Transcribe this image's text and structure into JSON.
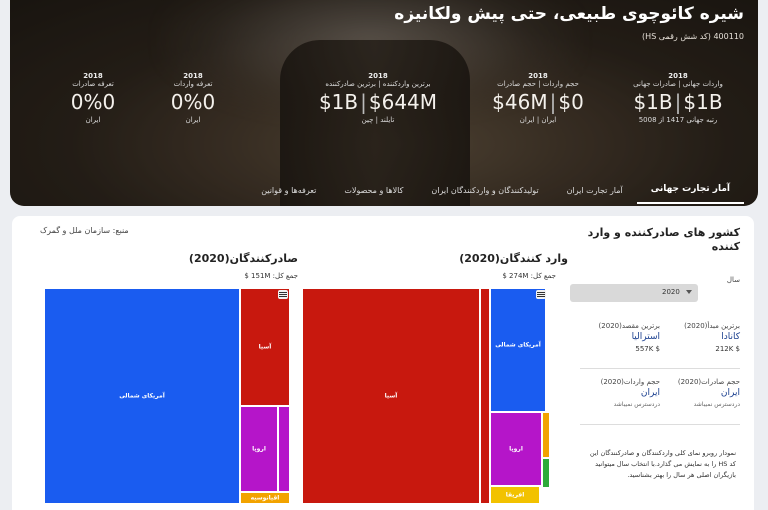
{
  "hero": {
    "title": "شیره کائوچوی طبیعی، حتی پیش ولکانیزه",
    "code": "400110 (کد شش رقمی HS)",
    "stats": [
      {
        "year": "2018",
        "label": "واردات جهانی | صادرات جهانی",
        "value_a": "$1B",
        "value_b": "$1B",
        "sub": "رتبه جهانی 1417 از 5008"
      },
      {
        "year": "2018",
        "label": "حجم واردات | حجم صادرات",
        "value_a": "$46M",
        "value_b": "$0",
        "sub": "ایران | ایران"
      },
      {
        "year": "2018",
        "label": "برترین واردکننده | برترین صادرکننده",
        "value_a": "$644M",
        "value_b": "$1B",
        "sub": "تایلند | چین"
      },
      {
        "year": "2018",
        "label": "تعرفه واردات",
        "value_a": "0%0",
        "value_b": "",
        "sub": "ایران"
      },
      {
        "year": "2018",
        "label": "تعرفه صادرات",
        "value_a": "0%0",
        "value_b": "",
        "sub": "ایران"
      }
    ],
    "tabs": [
      "آمار تجارت جهانی",
      "آمار تجارت ایران",
      "تولیدکنندگان و واردکنندگان ایران",
      "کالاها و محصولات",
      "تعرفه‌ها و قوانین"
    ]
  },
  "source": "منبع: سازمان ملل و گمرک",
  "panel": {
    "title": "کشور های صادرکننده و وارد کننده",
    "year_label": "سال",
    "year_value": "2020",
    "top_origin_label": "برترین مبدأ(2020)",
    "top_origin_name": "کانادا",
    "top_origin_value": "$ 212K",
    "top_dest_label": "برترین مقصد(2020)",
    "top_dest_name": "استرالیا",
    "top_dest_value": "$ 557K",
    "export_vol_label": "حجم صادرات(2020)",
    "export_vol_name": "ایران",
    "export_vol_value": "دردسترس نمیباشد",
    "import_vol_label": "حجم واردات(2020)",
    "import_vol_name": "ایران",
    "import_vol_value": "دردسترس نمیباشد",
    "description": "نمودار روبرو نمای کلی واردکنندگان و صادرکنندگان این کد HS را به نمایش می گذارد.با انتخاب سال میتوانید بازیگران اصلی هر سال را بهتر بشناسید."
  },
  "importers": {
    "title": "وارد کنندگان(2020)",
    "total": "جمع کل: 274M $",
    "regions": [
      {
        "name": "آسیا",
        "color": "#c8180e"
      },
      {
        "name": "آمریکای شمالی",
        "color": "#1a5cf0"
      },
      {
        "name": "اروپا",
        "color": "#b515c9"
      },
      {
        "name": "افریقا",
        "color": "#f2c200"
      }
    ]
  },
  "exporters": {
    "title": "صادرکنندگان(2020)",
    "total": "جمع کل: 151M $",
    "regions": [
      {
        "name": "آمریکای شمالی",
        "color": "#1a5cf0"
      },
      {
        "name": "آسیا",
        "color": "#c8180e"
      },
      {
        "name": "اروپا",
        "color": "#b515c9"
      },
      {
        "name": "اقیانوسیه",
        "color": "#f2a300"
      }
    ]
  }
}
